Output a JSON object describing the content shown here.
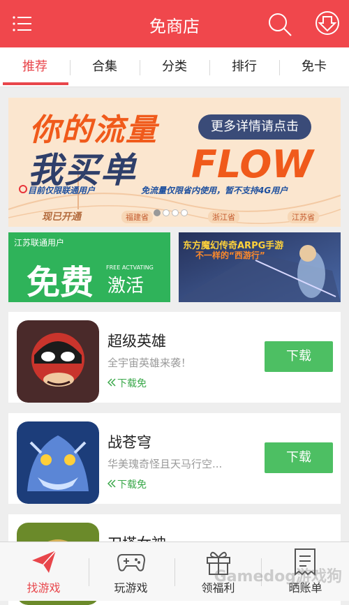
{
  "header": {
    "title": "免商店"
  },
  "tabs": [
    {
      "label": "推荐",
      "active": true
    },
    {
      "label": "合集"
    },
    {
      "label": "分类"
    },
    {
      "label": "排行"
    },
    {
      "label": "免卡"
    }
  ],
  "banner": {
    "line1": "你的流量",
    "line2": "我买单",
    "flow": "FLOW",
    "more": "更多详情请点击",
    "note1": "目前仅限联通用户",
    "note2": "免流量仅限省内使用，暂不支持4G用户",
    "opened": "现已开通",
    "cities": [
      "福建省",
      "浙江省",
      "江苏省"
    ]
  },
  "promo_free": {
    "small": "江苏联通用户",
    "big": "免费",
    "english": "FREE ACTVATING",
    "activate": "激活"
  },
  "promo_game": {
    "title": "东方魔幻传奇ARPG手游",
    "subtitle": "不一样的“西游行”"
  },
  "apps": [
    {
      "name": "超级英雄",
      "desc": "全宇宙英雄来袭！",
      "sub": "下载免",
      "button": "下载"
    },
    {
      "name": "战苍穹",
      "desc": "华美瑰奇怪且天马行空...",
      "sub": "下载免",
      "button": "下载"
    },
    {
      "name": "刀塔女神"
    }
  ],
  "bottom_nav": [
    {
      "label": "找游戏",
      "icon": "paper-plane-icon",
      "active": true
    },
    {
      "label": "玩游戏",
      "icon": "gamepad-icon"
    },
    {
      "label": "领福利",
      "icon": "gift-icon"
    },
    {
      "label": "晒账单",
      "icon": "receipt-icon"
    }
  ],
  "watermark": "Gamedog游戏狗",
  "colors": {
    "brand_red": "#f0474c",
    "download_green": "#4dbf63"
  }
}
